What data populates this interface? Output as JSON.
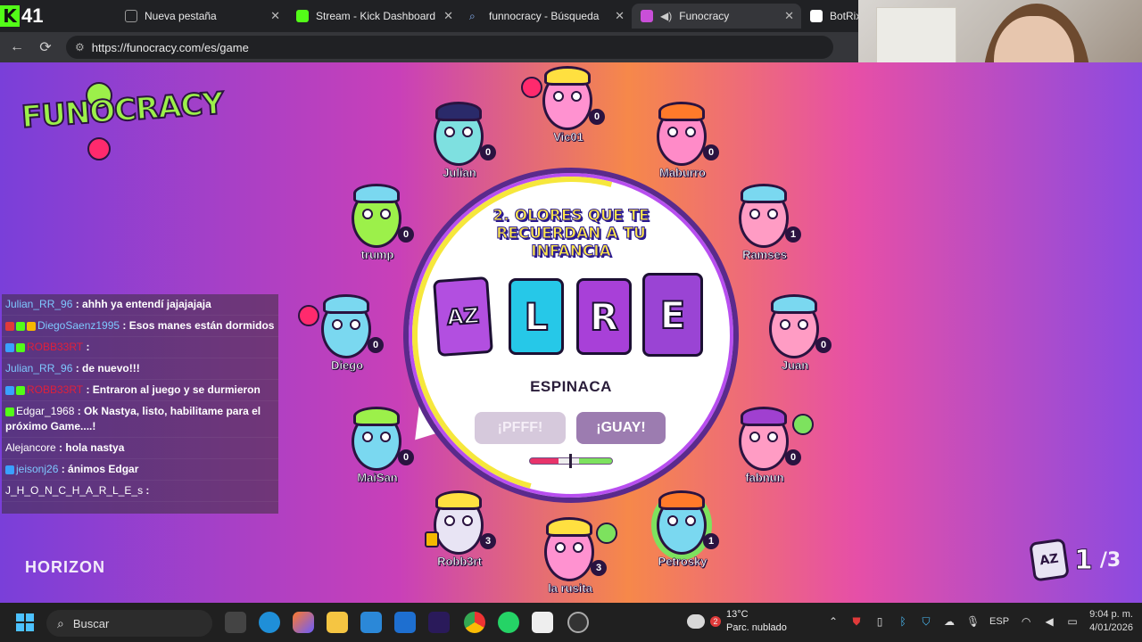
{
  "browser": {
    "badge_count": "41",
    "tabs": [
      {
        "label": "Nueva pestaña",
        "color": "#5a5a5a"
      },
      {
        "label": "Stream - Kick Dashboard",
        "color": "#53fc18"
      },
      {
        "label": "funnocracy - Búsqueda",
        "color": "#3a7bd5"
      },
      {
        "label": "Funocracy",
        "color": "#c94fd8"
      },
      {
        "label": "BotRix |",
        "color": "#ffffff"
      }
    ],
    "url": "https://funocracy.com/es/game"
  },
  "game": {
    "logo": "FUNOCRACY",
    "studio": "HORIZON",
    "question": "2. OLORES QUE TE RECUERDAN A TU INFANCIA",
    "tiles": [
      {
        "letter": "AZ",
        "color": "#b24fe0"
      },
      {
        "letter": "L",
        "color": "#26c8e8"
      },
      {
        "letter": "R",
        "color": "#a840d8"
      },
      {
        "letter": "E",
        "color": "#9a44d4"
      }
    ],
    "answer": "ESPINACA",
    "vote_pfff": "¡PFFF!",
    "vote_guay": "¡GUAY!",
    "meter_position": 0.5,
    "round_current": "1",
    "round_total": "/3",
    "players": [
      {
        "name": "Vic01",
        "score": "0",
        "skin": "#ff92d0",
        "hair": "#ffe040"
      },
      {
        "name": "Julian",
        "score": "0",
        "skin": "#7ee0e0",
        "hair": "#2a2a6a"
      },
      {
        "name": "Maburro",
        "score": "0",
        "skin": "#ff8bc8",
        "hair": "#ff7a2a"
      },
      {
        "name": "trump",
        "score": "0",
        "skin": "#9cf04a",
        "hair": "#7ad8f0"
      },
      {
        "name": "Ramses",
        "score": "1",
        "skin": "#ff9cc4",
        "hair": "#7ad8f0"
      },
      {
        "name": "Diego",
        "score": "0",
        "skin": "#7ad8f0",
        "hair": "#7ad8f0"
      },
      {
        "name": "Juan",
        "score": "0",
        "skin": "#ff9cc4",
        "hair": "#7ad8f0"
      },
      {
        "name": "MaiSan",
        "score": "0",
        "skin": "#7ad8f0",
        "hair": "#9cf04a"
      },
      {
        "name": "fabnun",
        "score": "0",
        "skin": "#ff9cc4",
        "hair": "#a040d0"
      },
      {
        "name": "Robb3rt",
        "score": "3",
        "skin": "#e8e4f4",
        "hair": "#ffe040"
      },
      {
        "name": "la rusita",
        "score": "3",
        "skin": "#ff92d0",
        "hair": "#ffe040"
      },
      {
        "name": "Petrosky",
        "score": "1",
        "skin": "#7ad8f0",
        "hair": "#ff7a2a"
      }
    ]
  },
  "chat": [
    {
      "user": "Julian_RR_96",
      "user_color": "#7ec8ff",
      "msg": " : ahhh ya entendí jajajajaja",
      "badges": []
    },
    {
      "user": "DiegoSaenz1995",
      "user_color": "#7ec8ff",
      "msg": " : Esos manes están dormidos",
      "badges": [
        "#e03a3a",
        "#53fc18",
        "#f5b800"
      ]
    },
    {
      "user": "ROBB33RT",
      "user_color": "#e0203a",
      "msg": " :",
      "badges": [
        "#3aa0ff",
        "#53fc18"
      ]
    },
    {
      "user": "Julian_RR_96",
      "user_color": "#7ec8ff",
      "msg": " : de nuevo!!!",
      "badges": []
    },
    {
      "user": "ROBB33RT",
      "user_color": "#e0203a",
      "msg": " : Entraron al juego y se durmieron",
      "badges": [
        "#3aa0ff",
        "#53fc18"
      ]
    },
    {
      "user": "Edgar_1968",
      "user_color": "#ffffff",
      "msg": " : Ok Nastya, listo, habilitame para el próximo Game....!",
      "badges": [
        "#53fc18"
      ]
    },
    {
      "user": "Alejancore",
      "user_color": "#ffffff",
      "msg": " : hola nastya",
      "badges": []
    },
    {
      "user": "jeisonj26",
      "user_color": "#7ec8ff",
      "msg": " : ánimos Edgar",
      "badges": [
        "#3aa0ff"
      ]
    },
    {
      "user": "J_H_O_N_C_H_A_R_L_E_s",
      "user_color": "#ffffff",
      "msg": " :",
      "badges": []
    }
  ],
  "taskbar": {
    "search_placeholder": "Buscar",
    "weather_temp": "13°C",
    "weather_desc": "Parc. nublado",
    "weather_badge": "2",
    "lang": "ESP",
    "time": "9:04 p. m.",
    "date": "4/01/2026"
  }
}
